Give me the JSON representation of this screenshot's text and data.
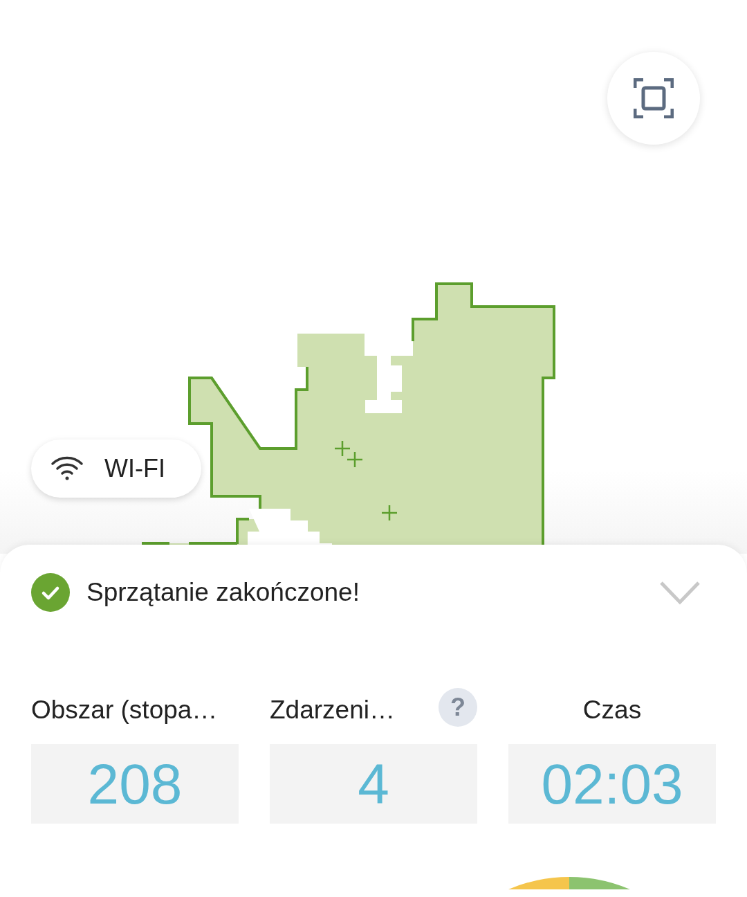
{
  "map": {
    "connection_label": "WI-FI"
  },
  "status": {
    "title": "Sprzątanie zakończone!",
    "done": true,
    "expanded": false
  },
  "stats": [
    {
      "label": "Obszar (stopa…",
      "value": "208"
    },
    {
      "label": "Zdarzeni…",
      "value": "4",
      "help": "?"
    },
    {
      "label": "Czas",
      "value": "02:03"
    }
  ]
}
